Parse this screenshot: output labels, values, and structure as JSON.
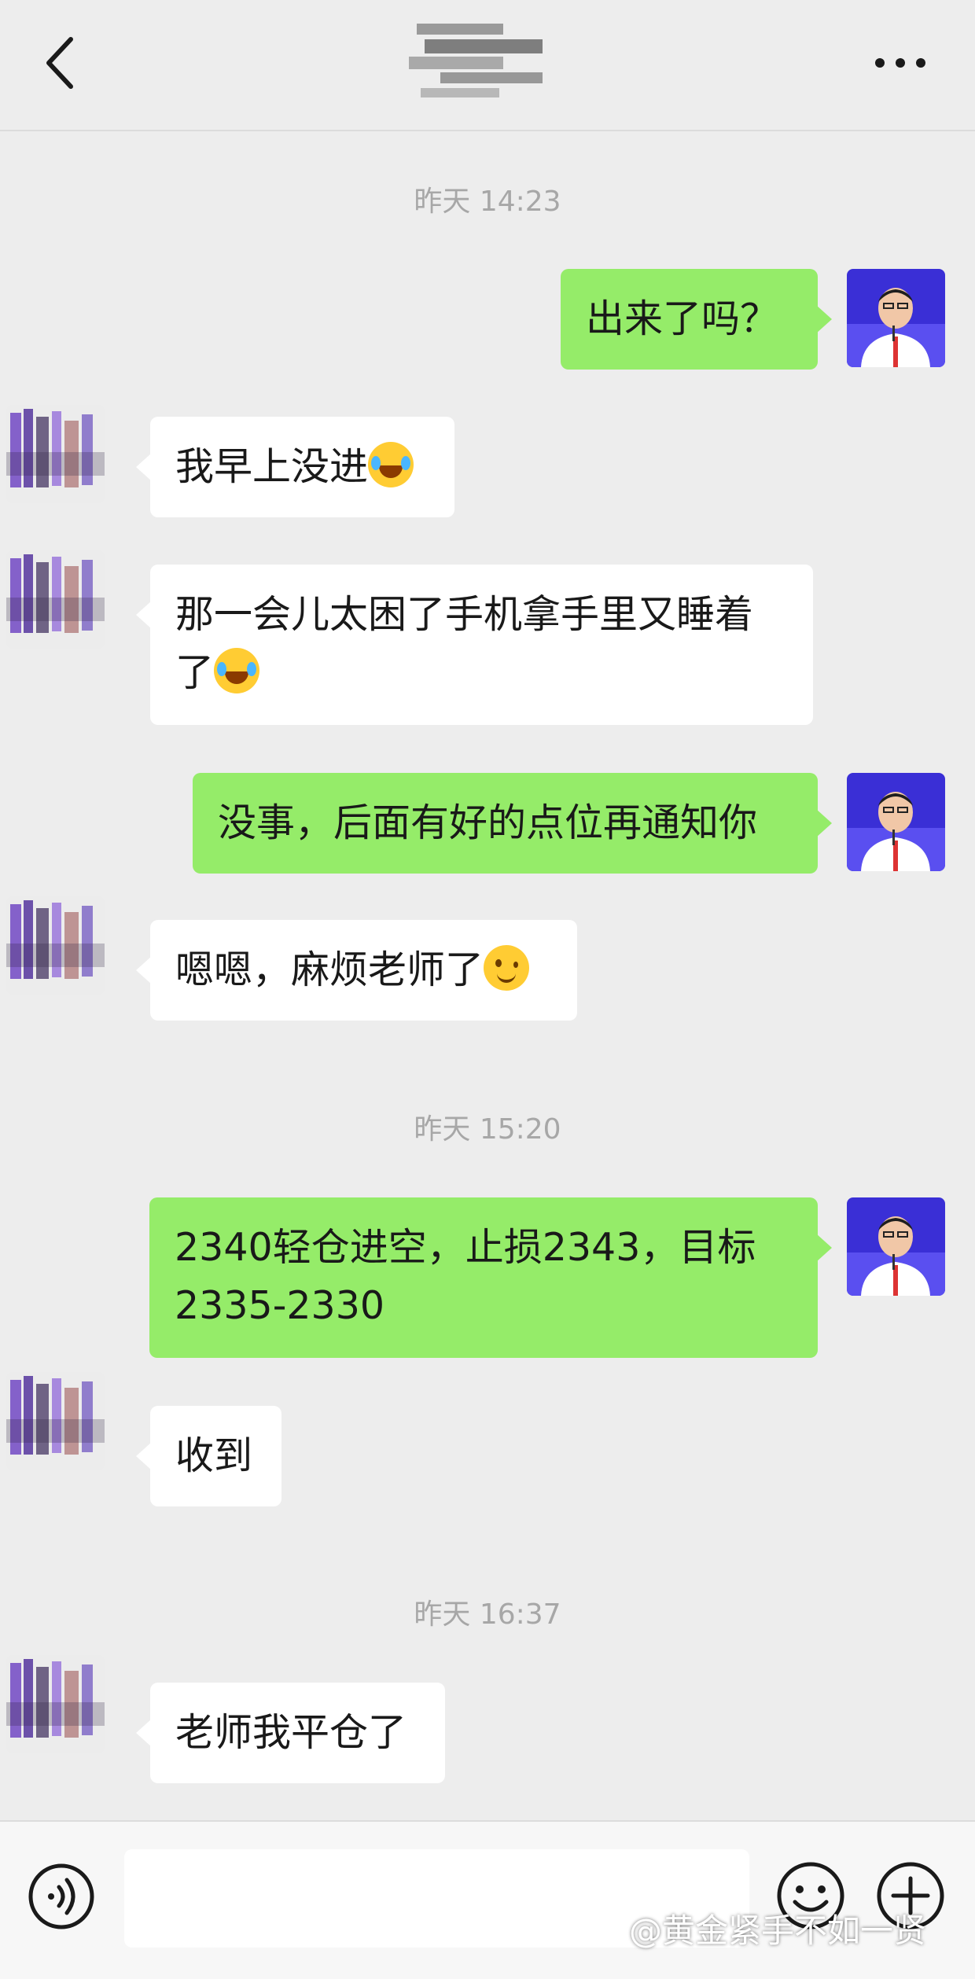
{
  "header": {
    "back_icon": "chevron-left-icon",
    "more_icon": "more-dots-icon"
  },
  "timestamps": [
    "昨天 14:23",
    "昨天 15:20",
    "昨天 16:37"
  ],
  "messages": [
    {
      "side": "out",
      "text": "出来了吗？"
    },
    {
      "side": "in",
      "text": "我早上没进",
      "emoji": "laugh"
    },
    {
      "side": "in",
      "text": "那一会儿太困了手机拿手里又睡着了",
      "emoji": "laugh"
    },
    {
      "side": "out",
      "text": "没事，后面有好的点位再通知你"
    },
    {
      "side": "in",
      "text": "嗯嗯，麻烦老师了",
      "emoji": "wink"
    },
    {
      "side": "out",
      "text": "2340轻仓进空，止损2343，目标2335-2330"
    },
    {
      "side": "in",
      "text": "收到"
    },
    {
      "side": "in",
      "text": "老师我平仓了"
    }
  ],
  "input_bar": {
    "voice_icon": "voice-icon",
    "emoji_icon": "emoji-icon",
    "plus_icon": "plus-icon",
    "text_value": ""
  },
  "watermark": "@黄金紧手不如一贤",
  "colors": {
    "background": "#ededed",
    "outgoing_bubble": "#95ec69",
    "incoming_bubble": "#ffffff",
    "timestamp": "#a7a7a7"
  }
}
